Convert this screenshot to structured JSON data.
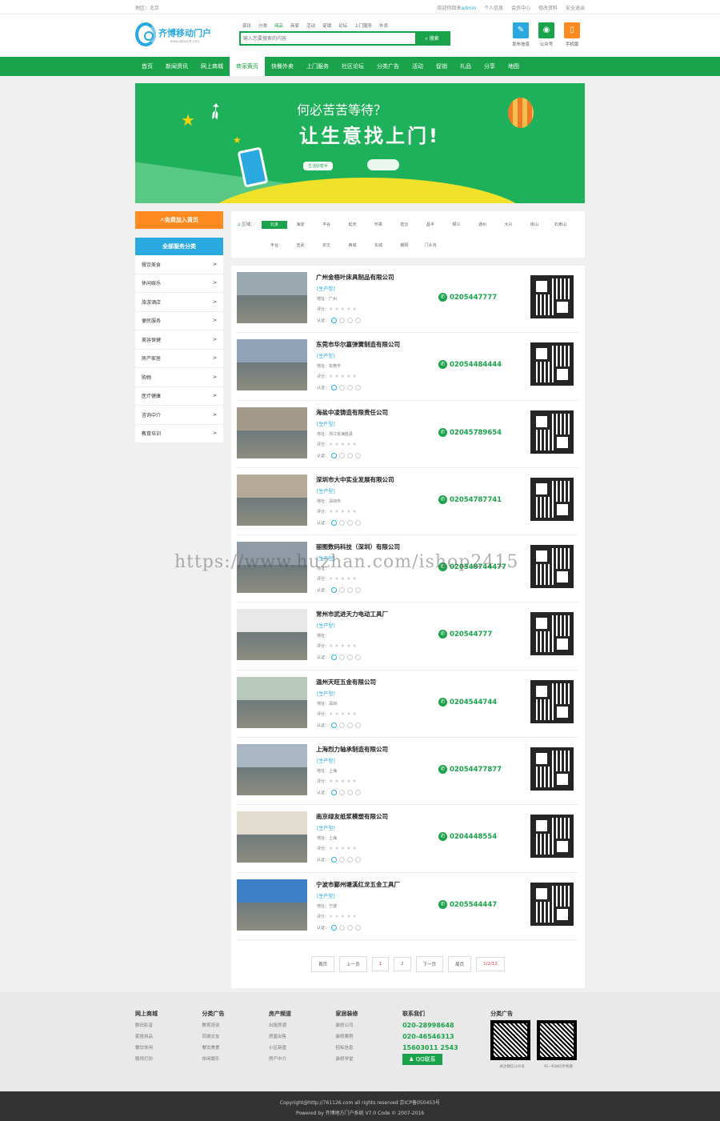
{
  "topbar": {
    "region": "地区：北京",
    "welcome": "欢迎你回来",
    "user": "admin",
    "links": [
      "个人信息",
      "会员中心",
      "修改资料",
      "安全退出"
    ]
  },
  "logo": {
    "name": "齐博移动门户",
    "sub": "www.qibosoft.com"
  },
  "search": {
    "cats": [
      "资讯",
      "分类",
      "商品",
      "商家",
      "活动",
      "促销",
      "论坛",
      "上门服务",
      "外卖"
    ],
    "active": "商品",
    "placeholder": "输入您要搜索的内容",
    "button": "搜索"
  },
  "header_icons": [
    {
      "label": "发布信息",
      "icon": "edit-icon",
      "color": "#2aa9e0"
    },
    {
      "label": "公众号",
      "icon": "wechat-icon",
      "color": "#1aa34a"
    },
    {
      "label": "手机版",
      "icon": "mobile-icon",
      "color": "#ff8a1f"
    }
  ],
  "nav": {
    "items": [
      "首页",
      "新闻资讯",
      "网上商城",
      "商家黄页",
      "快餐外卖",
      "上门服务",
      "社区论坛",
      "分类广告",
      "活动",
      "促销",
      "礼品",
      "分享",
      "地图"
    ],
    "active": "商家黄页"
  },
  "banner": {
    "line1": "何必苦苦等待？",
    "line2": "让生意找上门!",
    "button": "生活好帮手"
  },
  "sidebar": {
    "join": "✍免费加入黄页",
    "cat_title": "全部服务分类",
    "cats": [
      "餐饮美食",
      "休闲娱乐",
      "旅游酒店",
      "便民服务",
      "美容保健",
      "房产家居",
      "购物",
      "医疗健康",
      "咨询中介",
      "教育培训"
    ]
  },
  "filter": {
    "label": "区域：",
    "items": [
      "北京",
      "海淀",
      "平谷",
      "延庆",
      "怀柔",
      "密云",
      "昌平",
      "顺义",
      "通州",
      "大兴",
      "房山",
      "石景山",
      "丰台",
      "宣武",
      "崇文",
      "西城",
      "东城",
      "朝阳",
      "门头沟"
    ],
    "active": "北京"
  },
  "companies": [
    {
      "name": "广州金梧叶床具制品有限公司",
      "type": "[生产型]",
      "addr": "地址：广州",
      "phone": "0205447777"
    },
    {
      "name": "东莞市华尔嘉弹簧制造有限公司",
      "type": "[生产型]",
      "addr": "地址：东莞市",
      "phone": "02054484444"
    },
    {
      "name": "海盐中凌铸造有限责任公司",
      "type": "[生产型]",
      "addr": "地址：浙江省海盐县",
      "phone": "02045789654"
    },
    {
      "name": "深圳市大中实业发展有限公司",
      "type": "[生产型]",
      "addr": "地址：深圳市",
      "phone": "02054787741"
    },
    {
      "name": "丽图数码科技（深圳）有限公司",
      "type": "[生产型]",
      "addr": "地址：",
      "phone": "020548744477"
    },
    {
      "name": "常州市武进天力电动工具厂",
      "type": "[生产型]",
      "addr": "地址：",
      "phone": "020544777"
    },
    {
      "name": "温州天旺五金有限公司",
      "type": "[生产型]",
      "addr": "地址：深圳",
      "phone": "0204544744"
    },
    {
      "name": "上海烈力轴承制造有限公司",
      "type": "[生产型]",
      "addr": "地址：上海",
      "phone": "02054477877"
    },
    {
      "name": "南京绿友纸浆模塑有限公司",
      "type": "[生产型]",
      "addr": "地址：上海",
      "phone": "0204448554"
    },
    {
      "name": "宁波市鄞州塘溪红龙五金工具厂",
      "type": "[生产型]",
      "addr": "地址：宁波",
      "phone": "0205544447"
    }
  ],
  "labels": {
    "rate": "评分：",
    "stars": "★★★★★",
    "cert": "认证："
  },
  "pager": [
    "首页",
    "上一页",
    "1",
    "2",
    "下一页",
    "尾页",
    "1/2/12"
  ],
  "watermark": "https://www.huzhan.com/ishop2415",
  "footer": {
    "cols": [
      {
        "title": "网上商城",
        "items": [
          "数码影音",
          "家居用品",
          "餐饮休闲",
          "服饰打扮"
        ]
      },
      {
        "title": "分类广告",
        "items": [
          "教育培训",
          "同城交友",
          "餐饮美食",
          "休闲娱乐"
        ]
      },
      {
        "title": "房产频道",
        "items": [
          "出租房源",
          "房屋出售",
          "小区新盘",
          "房产中介"
        ]
      },
      {
        "title": "家居装修",
        "items": [
          "装修公司",
          "装修案例",
          "招标信息",
          "装修学堂"
        ]
      }
    ],
    "contact": {
      "title": "联系我们",
      "tels": [
        "020-28998648",
        "020-46546313",
        "15603011 2543"
      ],
      "qq": "QQ联系"
    },
    "ads": {
      "title": "分类广告",
      "qr1": "关注微信公众号",
      "qr2": "扫一扫访问手机版"
    }
  },
  "bottom": {
    "line1": "Copyright@http://761126.com all rights reserved 京ICP备050453号",
    "line2": "Powered by 齐博地方门户系统 V7.0 Code © 2007-2016"
  }
}
